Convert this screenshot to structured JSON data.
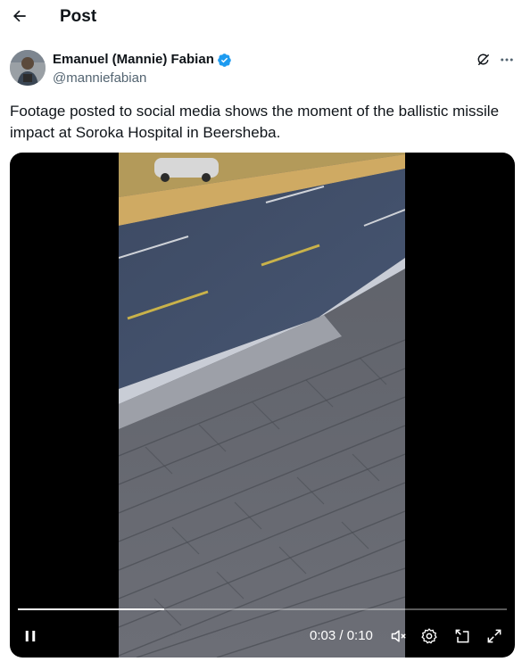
{
  "header": {
    "title": "Post",
    "back_icon": "arrow-left-icon"
  },
  "author": {
    "name": "Emanuel (Mannie) Fabian",
    "handle": "@manniefabian",
    "verified": true,
    "verified_color": "#1d9bf0"
  },
  "post": {
    "text": "Footage posted to social media shows the moment of the ballistic missile impact at Soroka Hospital in Beersheba."
  },
  "video": {
    "current_time": "0:03",
    "duration": "0:10",
    "time_display": "0:03 / 0:10",
    "progress": 0.3,
    "state": "playing",
    "controls": [
      "pause-icon",
      "muted-speaker-icon",
      "settings-icon",
      "pip-icon",
      "fullscreen-icon"
    ]
  },
  "colors": {
    "text": "#0f1419",
    "secondary": "#536471",
    "accent": "#1d9bf0"
  }
}
